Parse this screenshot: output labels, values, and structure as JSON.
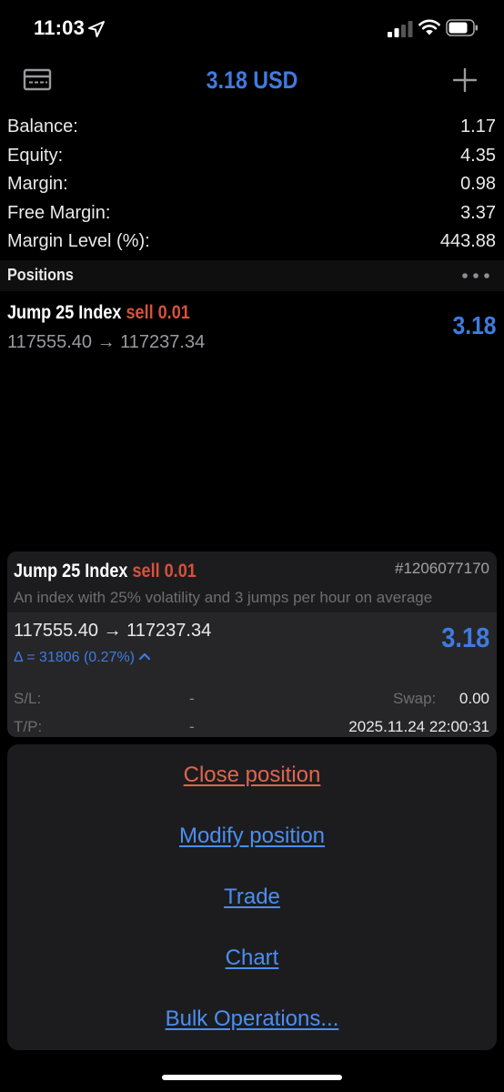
{
  "status_bar": {
    "time": "11:03"
  },
  "header": {
    "title": "3.18 USD",
    "accent_color": "#3f7be0"
  },
  "account": {
    "rows": [
      {
        "label": "Balance:",
        "value": "1.17"
      },
      {
        "label": "Equity:",
        "value": "4.35"
      },
      {
        "label": "Margin:",
        "value": "0.98"
      },
      {
        "label": "Free Margin:",
        "value": "3.37"
      },
      {
        "label": "Margin Level (%):",
        "value": "443.88"
      }
    ]
  },
  "positions": {
    "header": "Positions",
    "items": [
      {
        "symbol": "Jump 25 Index",
        "side": "sell 0.01",
        "prices": "117555.40 → 117237.34",
        "profit": "3.18"
      }
    ]
  },
  "detail": {
    "symbol": "Jump 25 Index",
    "side": "sell 0.01",
    "ticket": "#1206077170",
    "description": "An index with 25% volatility and 3 jumps per hour on average",
    "prices": "117555.40 → 117237.34",
    "profit": "3.18",
    "delta": "Δ = 31806 (0.27%)",
    "sl_label": "S/L:",
    "sl_value": "-",
    "tp_label": "T/P:",
    "tp_value": "-",
    "swap_label": "Swap:",
    "swap_value": "0.00",
    "time": "2025.11.24 22:00:31"
  },
  "actions": {
    "close": "Close position",
    "modify": "Modify position",
    "trade": "Trade",
    "chart": "Chart",
    "bulk": "Bulk Operations..."
  },
  "colors": {
    "sell": "#d8513b",
    "profit": "#3f7be0",
    "close_action": "#e0654f",
    "link": "#4c8ef0"
  }
}
